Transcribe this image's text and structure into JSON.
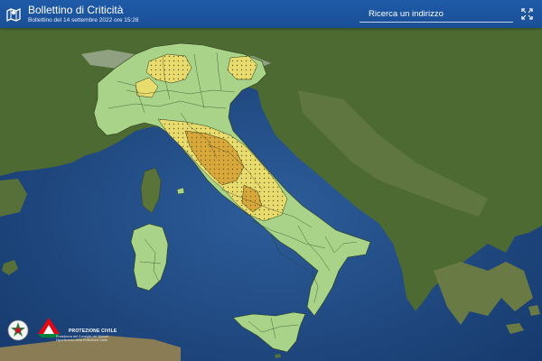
{
  "header": {
    "title": "Bollettino di Criticità",
    "subtitle": "Bollettino del 14 settembre 2022 ore 15:28",
    "search_label": "Ricerca un indirizzo",
    "logo_icon": "map-marker-logo-icon",
    "expand_icon": "fullscreen-expand-icon"
  },
  "footer": {
    "agency_name": "PROTEZIONE CIVILE",
    "agency_detail": "Presidenza del Consiglio dei Ministri Dipartimento della Protezione Civile",
    "emblem_icon": "italian-republic-emblem-icon",
    "logo_icon": "protezione-civile-logo-icon"
  },
  "map": {
    "colors": {
      "sea": "#1e4a86",
      "land": "#4d6a32",
      "alert_green": "#a8d389",
      "alert_yellow": "#e8dc6f",
      "alert_orange": "#d9a83a",
      "boundary": "#2a3a1c"
    }
  }
}
